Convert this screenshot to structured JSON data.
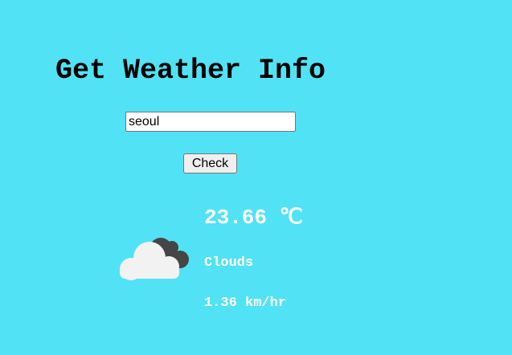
{
  "page": {
    "title": "Get Weather Info"
  },
  "search": {
    "city_value": "seoul",
    "check_label": "Check"
  },
  "result": {
    "icon": "clouds-icon",
    "temperature": "23.66 ℃",
    "description": "Clouds",
    "wind_speed": "1.36 km/hr"
  },
  "colors": {
    "background": "#51e2f5",
    "result_text": "#ffffff",
    "cloud_front": "#f2f2f2",
    "cloud_back": "#454545"
  }
}
